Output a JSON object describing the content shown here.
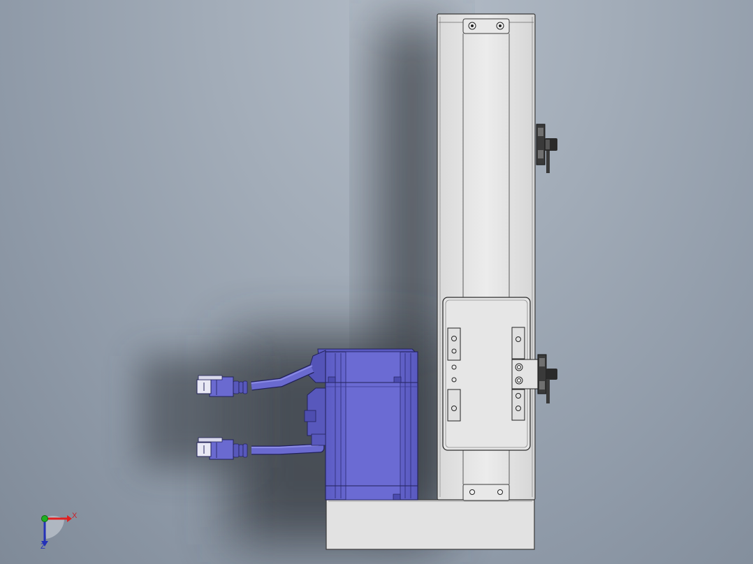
{
  "viewport": {
    "background_color": "#a2acb8",
    "model_colors": {
      "frame": "#e4e4e4",
      "frame_edge": "#3a3a3a",
      "motor": "#6a6ad0",
      "motor_dark": "#4e4eb4",
      "shadow": "#3b3f46"
    }
  },
  "triad": {
    "x_label": "X",
    "z_label": "Z",
    "x_color": "#e02020",
    "y_color": "#20b020",
    "z_color": "#2431b8"
  }
}
